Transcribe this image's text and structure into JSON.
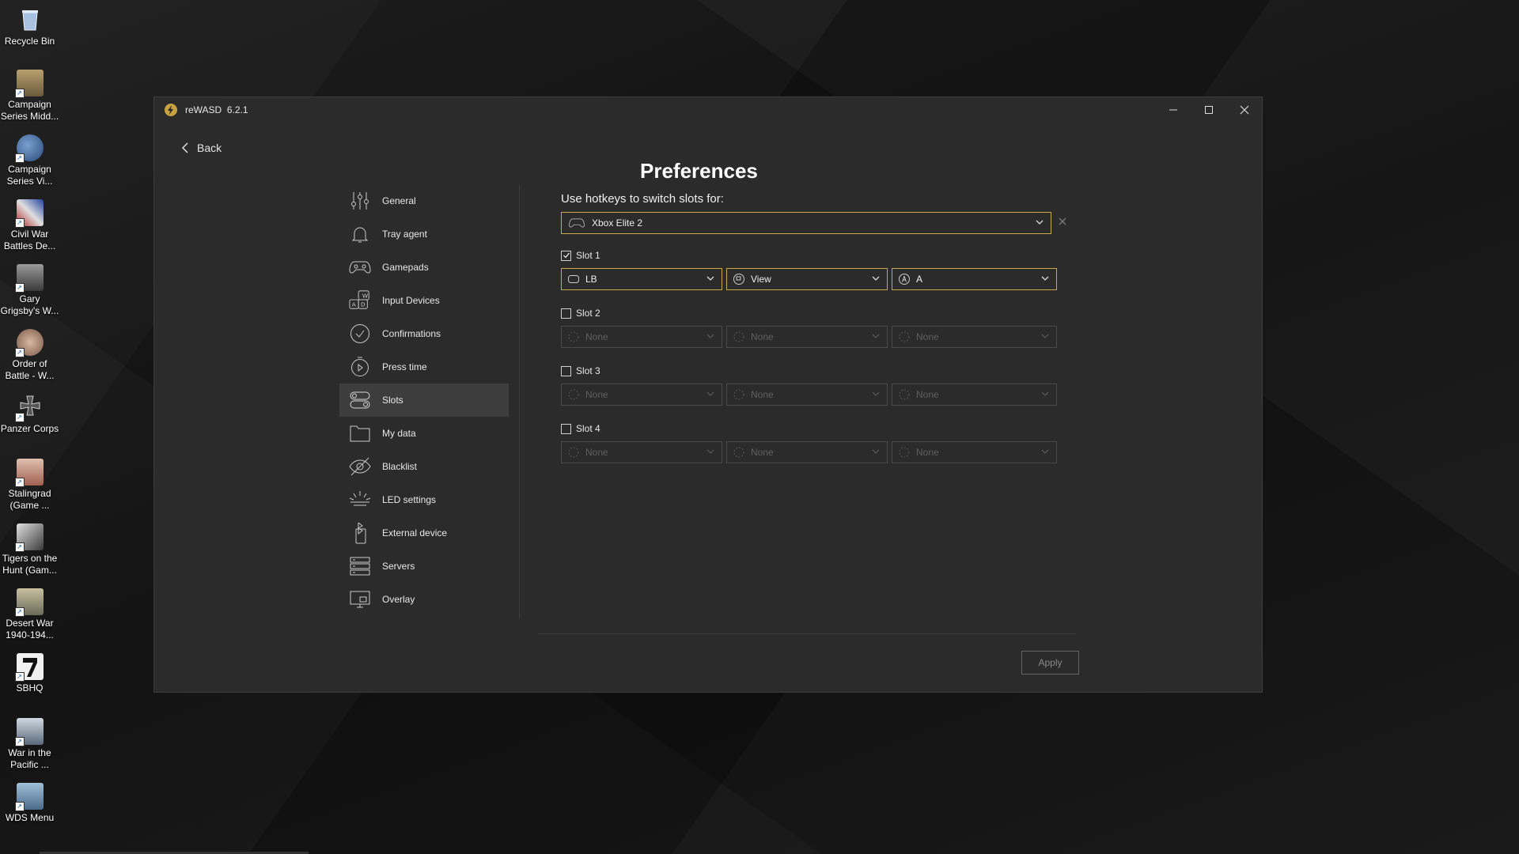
{
  "desktop": {
    "icons": [
      {
        "label": "Recycle Bin",
        "color": "#8aa4c8"
      },
      {
        "label": "Campaign Series Midd...",
        "color": "#9a8a5a"
      },
      {
        "label": "Campaign Series Vi...",
        "color": "#4a6a9a"
      },
      {
        "label": "Civil War Battles De...",
        "color": "#b03030"
      },
      {
        "label": "Gary Grigsby's W...",
        "color": "#6a6a6a"
      },
      {
        "label": "Order of Battle - W...",
        "color": "#a08070"
      },
      {
        "label": "Panzer Corps",
        "color": "#7a7a6a"
      },
      {
        "label": "Stalingrad (Game ...",
        "color": "#c89a8a"
      },
      {
        "label": "Tigers on the Hunt (Gam...",
        "color": "#8a8a8a"
      },
      {
        "label": "Desert War 1940-194...",
        "color": "#9a9a8a"
      },
      {
        "label": "SBHQ",
        "color": "#e8e8e8"
      },
      {
        "label": "War in the Pacific ...",
        "color": "#5a7a9a"
      },
      {
        "label": "WDS Menu",
        "color": "#7a9ab0"
      }
    ]
  },
  "window": {
    "app_name": "reWASD",
    "version": "6.2.1",
    "back_label": "Back",
    "title": "Preferences",
    "accent": "#c9a94a"
  },
  "menu": {
    "items": [
      {
        "label": "General",
        "icon": "sliders-icon"
      },
      {
        "label": "Tray agent",
        "icon": "bell-icon"
      },
      {
        "label": "Gamepads",
        "icon": "gamepad-icon"
      },
      {
        "label": "Input Devices",
        "icon": "keyboard-keys-icon"
      },
      {
        "label": "Confirmations",
        "icon": "check-circle-icon"
      },
      {
        "label": "Press time",
        "icon": "timer-icon"
      },
      {
        "label": "Slots",
        "icon": "toggle-slots-icon"
      },
      {
        "label": "My data",
        "icon": "folder-icon"
      },
      {
        "label": "Blacklist",
        "icon": "eye-off-icon"
      },
      {
        "label": "LED settings",
        "icon": "led-icon"
      },
      {
        "label": "External device",
        "icon": "bluetooth-device-icon"
      },
      {
        "label": "Servers",
        "icon": "server-icon"
      },
      {
        "label": "Overlay",
        "icon": "monitor-icon"
      }
    ],
    "active": "Slots"
  },
  "content": {
    "hint": "Use hotkeys to switch slots for:",
    "device": "Xbox Elite 2",
    "slots": [
      {
        "label": "Slot 1",
        "checked": true,
        "keys": [
          "LB",
          "View",
          "A"
        ]
      },
      {
        "label": "Slot 2",
        "checked": false,
        "keys": [
          "None",
          "None",
          "None"
        ]
      },
      {
        "label": "Slot 3",
        "checked": false,
        "keys": [
          "None",
          "None",
          "None"
        ]
      },
      {
        "label": "Slot 4",
        "checked": false,
        "keys": [
          "None",
          "None",
          "None"
        ]
      }
    ],
    "apply_label": "Apply"
  }
}
